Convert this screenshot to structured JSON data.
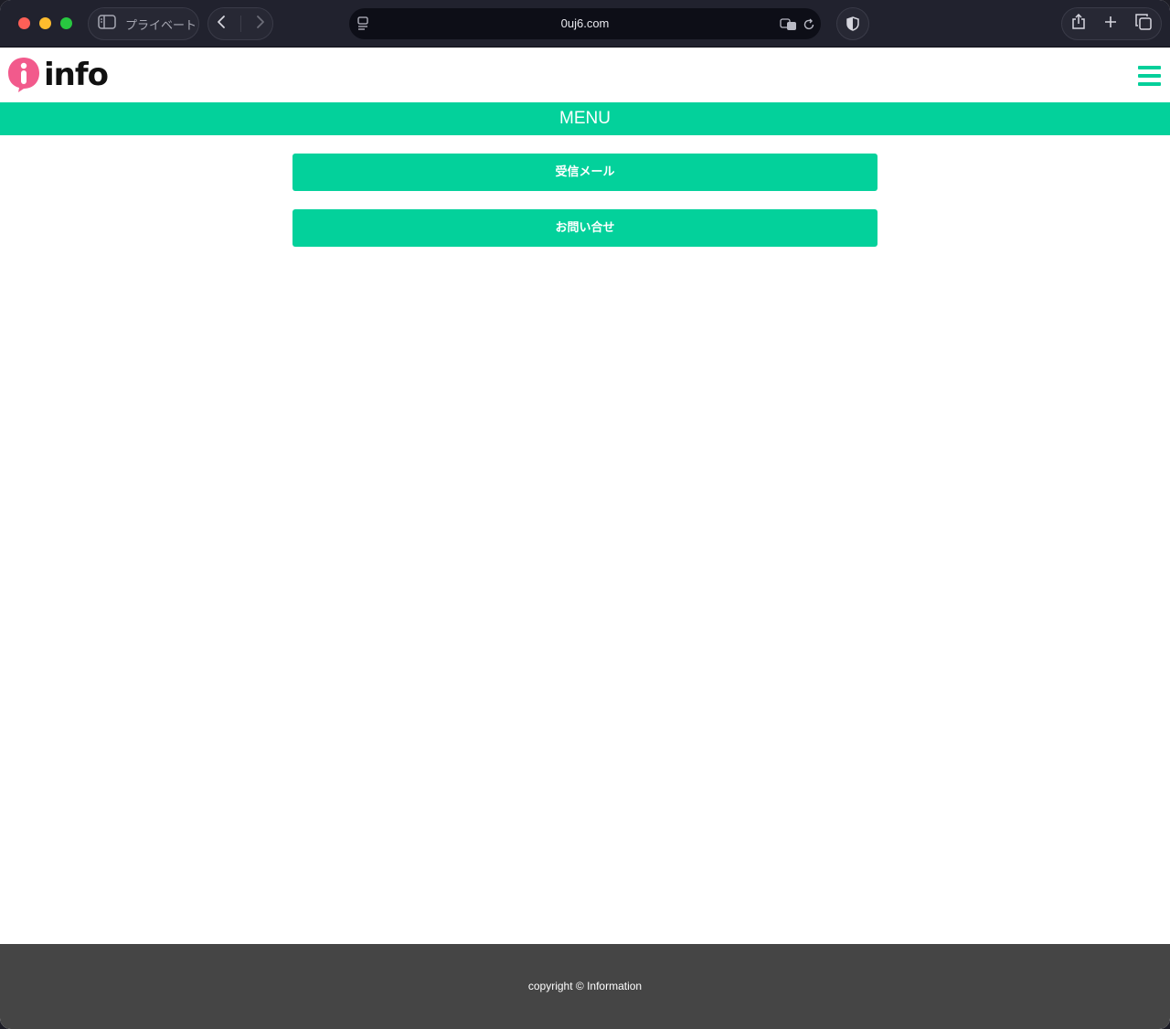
{
  "browser": {
    "private_label": "プライベート",
    "url": "0uj6.com"
  },
  "header": {
    "logo_text": "info",
    "colors": {
      "accent": "#03d19b",
      "logo_mark": "#f25a8c",
      "footer_bg": "#454545"
    }
  },
  "menu": {
    "title": "MENU",
    "items": [
      {
        "label": "受信メール"
      },
      {
        "label": "お問い合せ"
      }
    ]
  },
  "footer": {
    "copyright": "copyright © Information"
  }
}
